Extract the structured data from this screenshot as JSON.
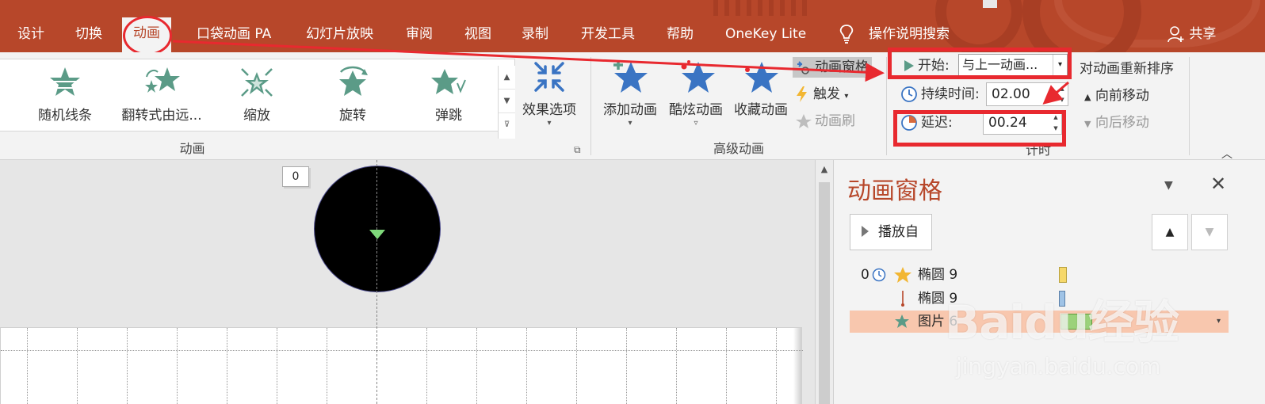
{
  "tabs": [
    {
      "label": "设计"
    },
    {
      "label": "切换"
    },
    {
      "label": "动画"
    },
    {
      "label": "口袋动画 PA"
    },
    {
      "label": "幻灯片放映"
    },
    {
      "label": "审阅"
    },
    {
      "label": "视图"
    },
    {
      "label": "录制"
    },
    {
      "label": "开发工具"
    },
    {
      "label": "帮助"
    },
    {
      "label": "OneKey Lite"
    }
  ],
  "tell_me": "操作说明搜索",
  "share": "共享",
  "gallery": {
    "items": [
      {
        "label": "随机线条"
      },
      {
        "label": "翻转式由远..."
      },
      {
        "label": "缩放"
      },
      {
        "label": "旋转"
      },
      {
        "label": "弹跳"
      }
    ]
  },
  "effect_options": "效果选项",
  "group_animation": "动画",
  "advanced": {
    "add_animation": "添加动画",
    "cool_animation": "酷炫动画",
    "favorite_animation": "收藏动画",
    "animation_pane": "动画窗格",
    "trigger": "触发",
    "painter": "动画刷",
    "group_label": "高级动画"
  },
  "timing": {
    "start_label": "开始:",
    "start_value": "与上一动画...",
    "duration_label": "持续时间:",
    "duration_value": "02.00",
    "delay_label": "延迟:",
    "delay_value": "00.24",
    "group_label": "计时"
  },
  "reorder": {
    "title": "对动画重新排序",
    "move_earlier": "向前移动",
    "move_later": "向后移动"
  },
  "slide": {
    "tag": "0"
  },
  "pane": {
    "title": "动画窗格",
    "play_from": "播放自",
    "items": [
      {
        "index": "0",
        "name": "椭圆 9"
      },
      {
        "index": "",
        "name": "椭圆 9"
      },
      {
        "index": "",
        "name": "图片 6"
      }
    ]
  },
  "watermark": {
    "main": "Baidu经验",
    "sub": "jingyan.baidu.com"
  },
  "colors": {
    "accent": "#b7472a",
    "annotation": "#e8292f",
    "icon_green": "#5b9b87",
    "star_blue": "#3a74c3"
  }
}
